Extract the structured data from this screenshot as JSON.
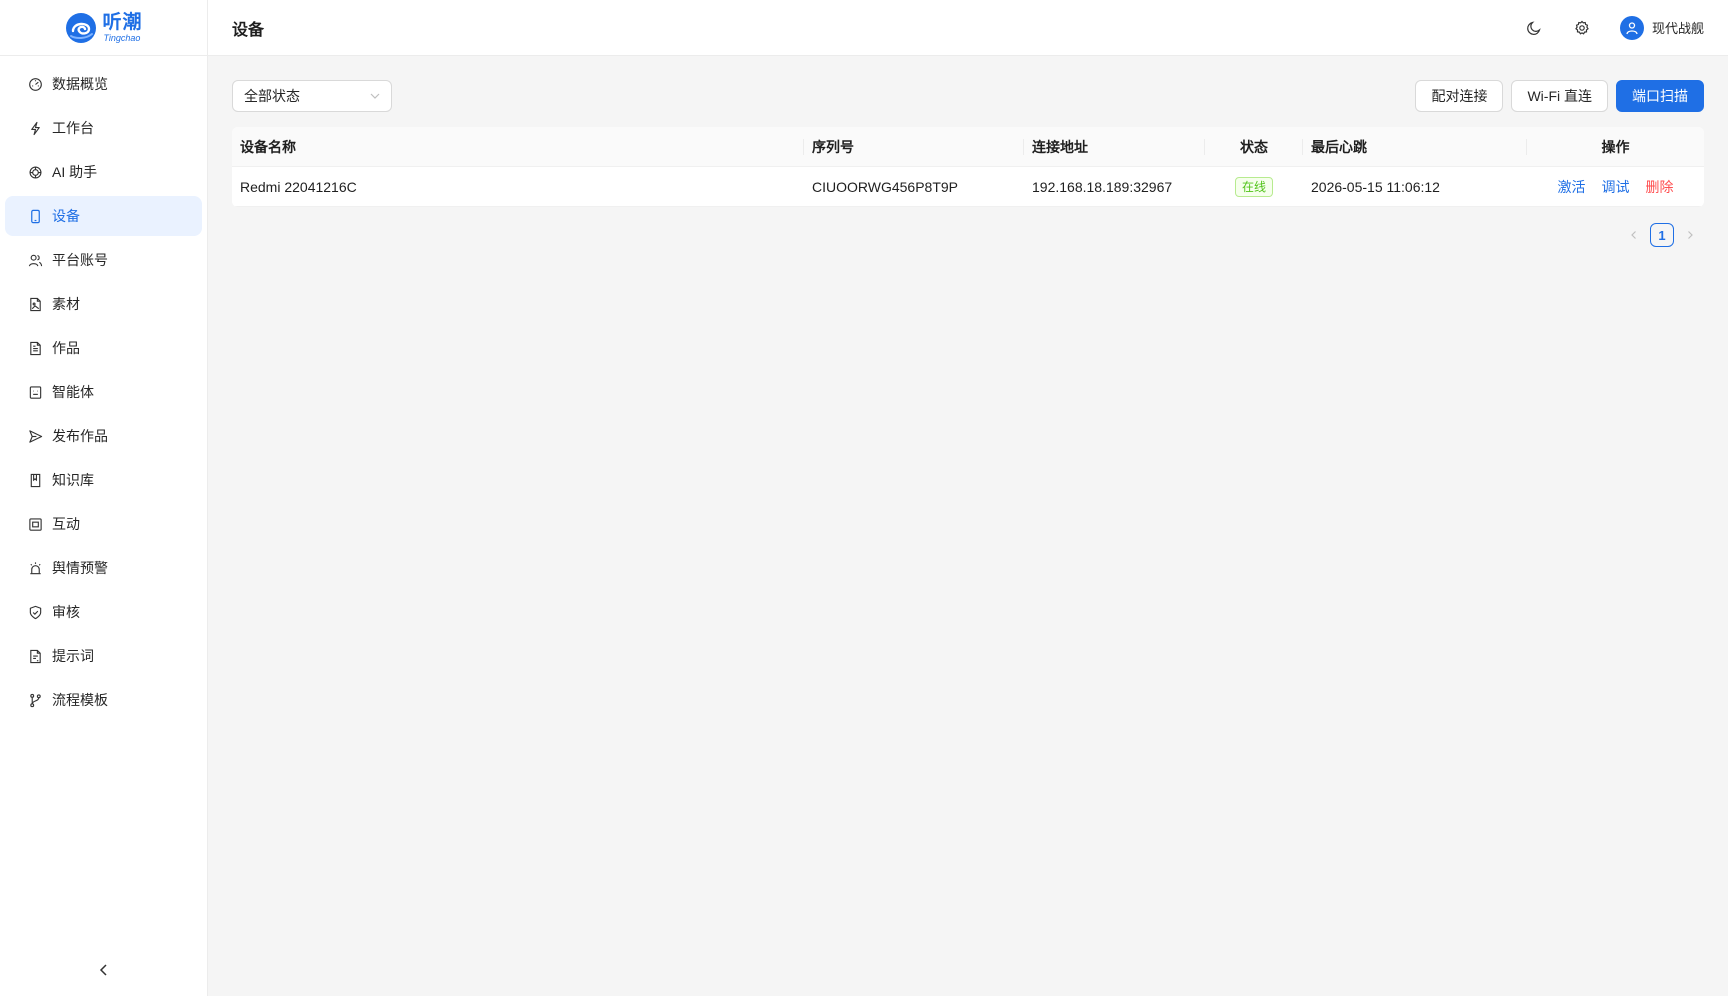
{
  "brand": {
    "name_cn": "听潮",
    "name_en": "Tingchao",
    "color": "#1f6fe5"
  },
  "sidebar": {
    "items": [
      {
        "label": "数据概览",
        "icon": "dashboard-icon",
        "active": false
      },
      {
        "label": "工作台",
        "icon": "lightning-icon",
        "active": false
      },
      {
        "label": "AI 助手",
        "icon": "ai-icon",
        "active": false
      },
      {
        "label": "设备",
        "icon": "phone-icon",
        "active": true
      },
      {
        "label": "平台账号",
        "icon": "users-icon",
        "active": false
      },
      {
        "label": "素材",
        "icon": "file-image-icon",
        "active": false
      },
      {
        "label": "作品",
        "icon": "file-text-icon",
        "active": false
      },
      {
        "label": "智能体",
        "icon": "robot-icon",
        "active": false
      },
      {
        "label": "发布作品",
        "icon": "send-icon",
        "active": false
      },
      {
        "label": "知识库",
        "icon": "book-icon",
        "active": false
      },
      {
        "label": "互动",
        "icon": "interaction-icon",
        "active": false
      },
      {
        "label": "舆情预警",
        "icon": "alarm-icon",
        "active": false
      },
      {
        "label": "审核",
        "icon": "shield-check-icon",
        "active": false
      },
      {
        "label": "提示词",
        "icon": "file-prompt-icon",
        "active": false
      },
      {
        "label": "流程模板",
        "icon": "branch-icon",
        "active": false
      }
    ],
    "collapse_icon": "chevron-left-icon"
  },
  "header": {
    "title": "设备",
    "theme_icon": "moon-icon",
    "settings_icon": "gear-icon",
    "user_name": "现代战舰"
  },
  "toolbar": {
    "status_filter": "全部状态",
    "pair_button": "配对连接",
    "wifi_button": "Wi-Fi 直连",
    "scan_button": "端口扫描"
  },
  "table": {
    "columns": [
      "设备名称",
      "序列号",
      "连接地址",
      "状态",
      "最后心跳",
      "操作"
    ],
    "rows": [
      {
        "name": "Redmi 22041216C",
        "serial": "CIUOORWG456P8T9P",
        "address": "192.168.18.189:32967",
        "status": "在线",
        "heartbeat": "2026-05-15 11:06:12",
        "actions": {
          "activate": "激活",
          "debug": "调试",
          "delete": "删除"
        }
      }
    ]
  },
  "pagination": {
    "current": "1"
  }
}
